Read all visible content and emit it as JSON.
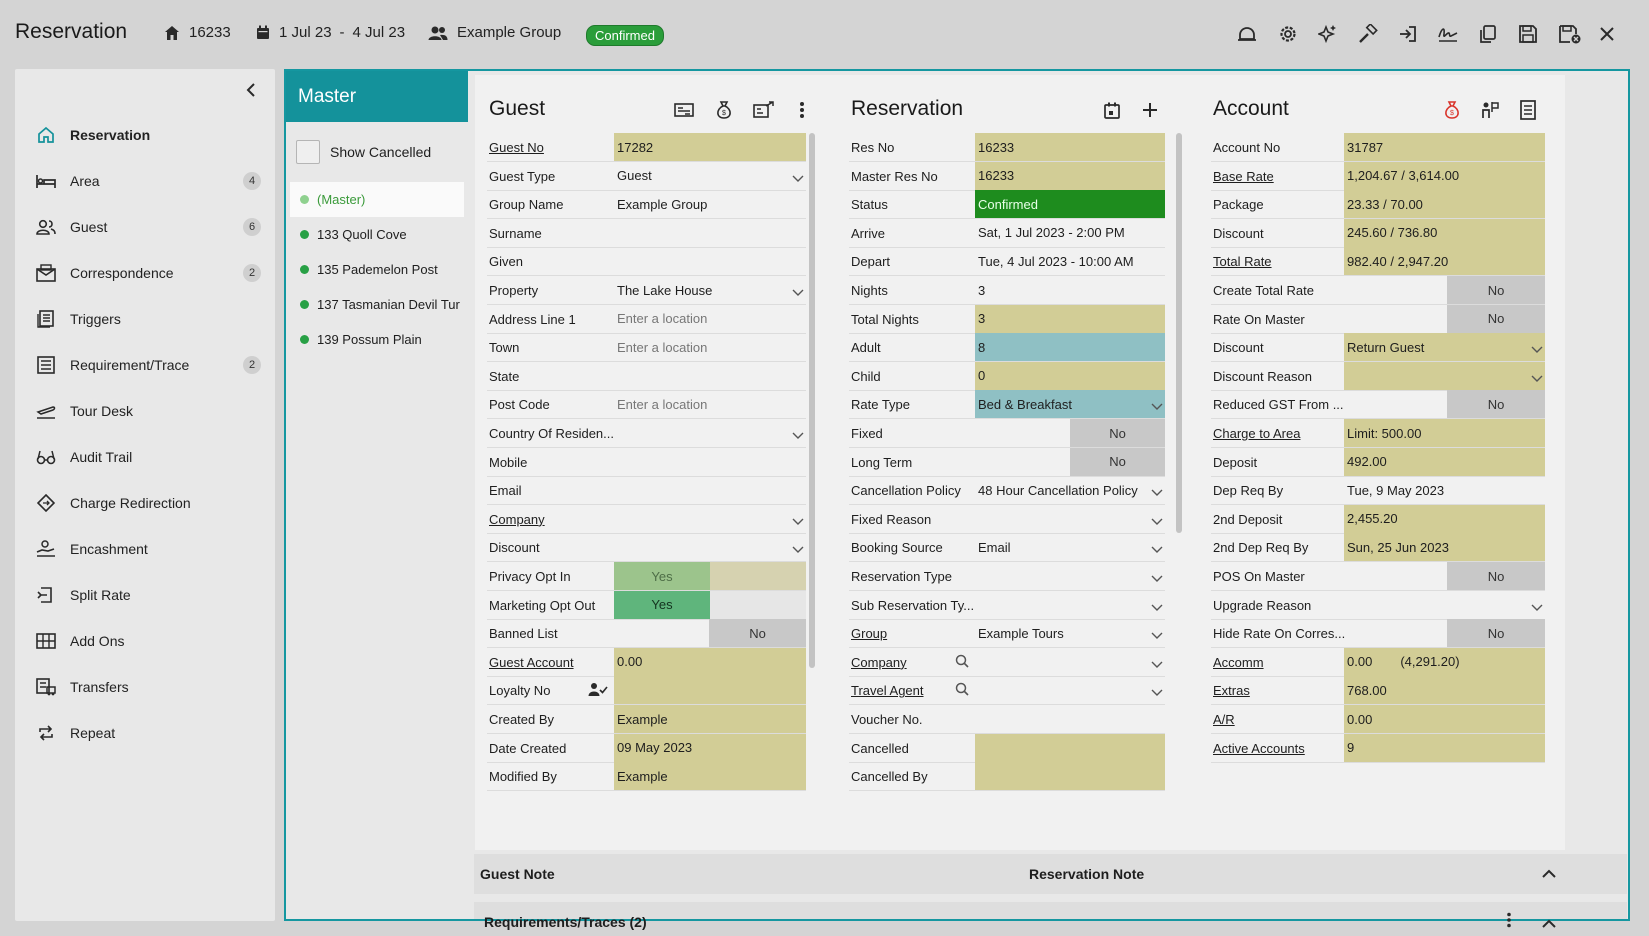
{
  "header": {
    "title": "Reservation",
    "res_no": "16233",
    "dates": "1 Jul 23",
    "dates_sep": "-",
    "dates_end": "4 Jul 23",
    "group": "Example Group",
    "status": "Confirmed",
    "icons": [
      "bell-icon",
      "gear-icon",
      "sparkle-icon",
      "hammer-icon",
      "sign-in-icon",
      "signature-icon",
      "copy-icon",
      "save-icon",
      "save-close-icon",
      "close-icon"
    ]
  },
  "sidebar": {
    "items": [
      {
        "label": "Reservation",
        "icon": "home-icon",
        "count": ""
      },
      {
        "label": "Area",
        "icon": "bed-icon",
        "count": "4"
      },
      {
        "label": "Guest",
        "icon": "people-icon",
        "count": "6"
      },
      {
        "label": "Correspondence",
        "icon": "mail-icon",
        "count": "2"
      },
      {
        "label": "Triggers",
        "icon": "triggers-icon",
        "count": ""
      },
      {
        "label": "Requirement/Trace",
        "icon": "list-icon",
        "count": "2"
      },
      {
        "label": "Tour Desk",
        "icon": "plane-icon",
        "count": ""
      },
      {
        "label": "Audit Trail",
        "icon": "glasses-icon",
        "count": ""
      },
      {
        "label": "Charge Redirection",
        "icon": "diamond-icon",
        "count": ""
      },
      {
        "label": "Encashment",
        "icon": "encash-icon",
        "count": ""
      },
      {
        "label": "Split Rate",
        "icon": "split-icon",
        "count": ""
      },
      {
        "label": "Add Ons",
        "icon": "addons-icon",
        "count": ""
      },
      {
        "label": "Transfers",
        "icon": "transfer-icon",
        "count": ""
      },
      {
        "label": "Repeat",
        "icon": "repeat-icon",
        "count": ""
      }
    ]
  },
  "master": {
    "title": "Master",
    "show_cancelled": "Show Cancelled",
    "items": [
      "(Master)",
      "133 Quoll Cove",
      "135 Pademelon Post",
      "137 Tasmanian Devil Tur",
      "139 Possum Plain"
    ]
  },
  "guest": {
    "title": "Guest",
    "rows": [
      {
        "label": "Guest No",
        "value": "17282",
        "link": true,
        "style": "yel"
      },
      {
        "label": "Guest Type",
        "value": "Guest",
        "dropdown": true
      },
      {
        "label": "Group Name",
        "value": "Example Group"
      },
      {
        "label": "Surname",
        "value": ""
      },
      {
        "label": "Given",
        "value": ""
      },
      {
        "label": "Property",
        "value": "The Lake House",
        "dropdown": true
      },
      {
        "label": "Address Line 1",
        "value": "Enter a location",
        "placeholder": true
      },
      {
        "label": "Town",
        "value": "Enter a location",
        "placeholder": true
      },
      {
        "label": "State",
        "value": ""
      },
      {
        "label": "Post Code",
        "value": "Enter a location",
        "placeholder": true
      },
      {
        "label": "Country Of Residen...",
        "value": "",
        "dropdown": true
      },
      {
        "label": "Mobile",
        "value": ""
      },
      {
        "label": "Email",
        "value": ""
      },
      {
        "label": "Company",
        "value": "",
        "link": true,
        "dropdown": true
      },
      {
        "label": "Discount",
        "value": "",
        "dropdown": true
      },
      {
        "label": "Privacy Opt In",
        "value": "Yes",
        "special": "privacy"
      },
      {
        "label": "Marketing Opt Out",
        "value": "Yes",
        "special": "marketing"
      },
      {
        "label": "Banned List",
        "value": "No",
        "special": "no"
      },
      {
        "label": "Guest Account",
        "value": "0.00",
        "link": true,
        "style": "yel"
      },
      {
        "label": "Loyalty No",
        "value": "",
        "style": "yel",
        "special": "loyalty"
      },
      {
        "label": "Created By",
        "value": "Example",
        "style": "yel"
      },
      {
        "label": "Date Created",
        "value": "09 May 2023",
        "style": "yel"
      },
      {
        "label": "Modified By",
        "value": "Example",
        "style": "yel"
      }
    ]
  },
  "reservation": {
    "title": "Reservation",
    "rows": [
      {
        "label": "Res No",
        "value": "16233",
        "style": "yel"
      },
      {
        "label": "Master Res No",
        "value": "16233",
        "style": "yel"
      },
      {
        "label": "Status",
        "value": "Confirmed",
        "style": "green"
      },
      {
        "label": "Arrive",
        "value": "Sat, 1 Jul 2023 - 2:00 PM"
      },
      {
        "label": "Depart",
        "value": "Tue, 4 Jul 2023 - 10:00 AM"
      },
      {
        "label": "Nights",
        "value": "3"
      },
      {
        "label": "Total Nights",
        "value": "3",
        "style": "yel"
      },
      {
        "label": "Adult",
        "value": "8",
        "style": "blue"
      },
      {
        "label": "Child",
        "value": "0",
        "style": "yel"
      },
      {
        "label": "Rate Type",
        "value": "Bed & Breakfast",
        "style": "blue",
        "dropdown": true
      },
      {
        "label": "Fixed",
        "value": "No",
        "special": "no"
      },
      {
        "label": "Long Term",
        "value": "No",
        "special": "no"
      },
      {
        "label": "Cancellation Policy",
        "value": "48 Hour Cancellation Policy",
        "dropdown": true
      },
      {
        "label": "Fixed Reason",
        "value": "",
        "dropdown": true
      },
      {
        "label": "Booking Source",
        "value": "Email",
        "dropdown": true
      },
      {
        "label": "Reservation Type",
        "value": "",
        "dropdown": true
      },
      {
        "label": "Sub Reservation Ty...",
        "value": "",
        "dropdown": true
      },
      {
        "label": "Group",
        "value": "Example Tours",
        "link": true,
        "dropdown": true
      },
      {
        "label": "Company",
        "value": "",
        "link": true,
        "dropdown": true,
        "search": true
      },
      {
        "label": "Travel Agent",
        "value": "",
        "link": true,
        "dropdown": true,
        "search": true
      },
      {
        "label": "Voucher No.",
        "value": ""
      },
      {
        "label": "Cancelled",
        "value": "",
        "style": "yel"
      },
      {
        "label": "Cancelled By",
        "value": "",
        "style": "yel"
      }
    ]
  },
  "account": {
    "title": "Account",
    "rows": [
      {
        "label": "Account No",
        "value": "31787",
        "style": "yel"
      },
      {
        "label": "Base Rate",
        "value": "1,204.67 / 3,614.00",
        "link": true,
        "style": "yel"
      },
      {
        "label": "Package",
        "value": "23.33 / 70.00",
        "style": "yel"
      },
      {
        "label": "Discount",
        "value": "245.60 / 736.80",
        "style": "yel"
      },
      {
        "label": "Total Rate",
        "value": "982.40 / 2,947.20",
        "link": true,
        "style": "yel"
      },
      {
        "label": "Create Total Rate",
        "value": "No",
        "special": "no"
      },
      {
        "label": "Rate On Master",
        "value": "No",
        "special": "no"
      },
      {
        "label": "Discount",
        "value": "Return Guest",
        "style": "yel",
        "dropdown": true
      },
      {
        "label": "Discount Reason",
        "value": "",
        "style": "yel",
        "dropdown": true
      },
      {
        "label": "Reduced GST From ...",
        "value": "No",
        "special": "no"
      },
      {
        "label": "Charge to Area",
        "value": "Limit: 500.00",
        "link": true,
        "style": "yel"
      },
      {
        "label": "Deposit",
        "value": "492.00",
        "style": "yel"
      },
      {
        "label": "Dep Req By",
        "value": "Tue, 9 May 2023"
      },
      {
        "label": "2nd Deposit",
        "value": "2,455.20",
        "style": "yel"
      },
      {
        "label": "2nd Dep Req By",
        "value": "Sun, 25 Jun 2023",
        "style": "yel"
      },
      {
        "label": "POS On Master",
        "value": "No",
        "special": "no"
      },
      {
        "label": "Upgrade Reason",
        "value": "",
        "dropdown": true
      },
      {
        "label": "Hide Rate On Corres...",
        "value": "No",
        "special": "no"
      },
      {
        "label": "Accomm",
        "value": "0.00",
        "value2": "(4,291.20)",
        "link": true,
        "style": "yel"
      },
      {
        "label": "Extras",
        "value": "768.00",
        "link": true,
        "style": "yel"
      },
      {
        "label": "A/R",
        "value": "0.00",
        "link": true,
        "style": "yel"
      },
      {
        "label": "Active Accounts",
        "value": "9",
        "link": true,
        "style": "yel"
      }
    ]
  },
  "notes": {
    "guest_note": "Guest Note",
    "reservation_note": "Reservation Note",
    "requirements": "Requirements/Traces (2)"
  },
  "colors": {
    "accent": "#14929b",
    "yellow": "#d2cd96",
    "green": "#1e8c1e",
    "blue": "#8fc0c4",
    "no_gray": "#c8c8c8"
  }
}
